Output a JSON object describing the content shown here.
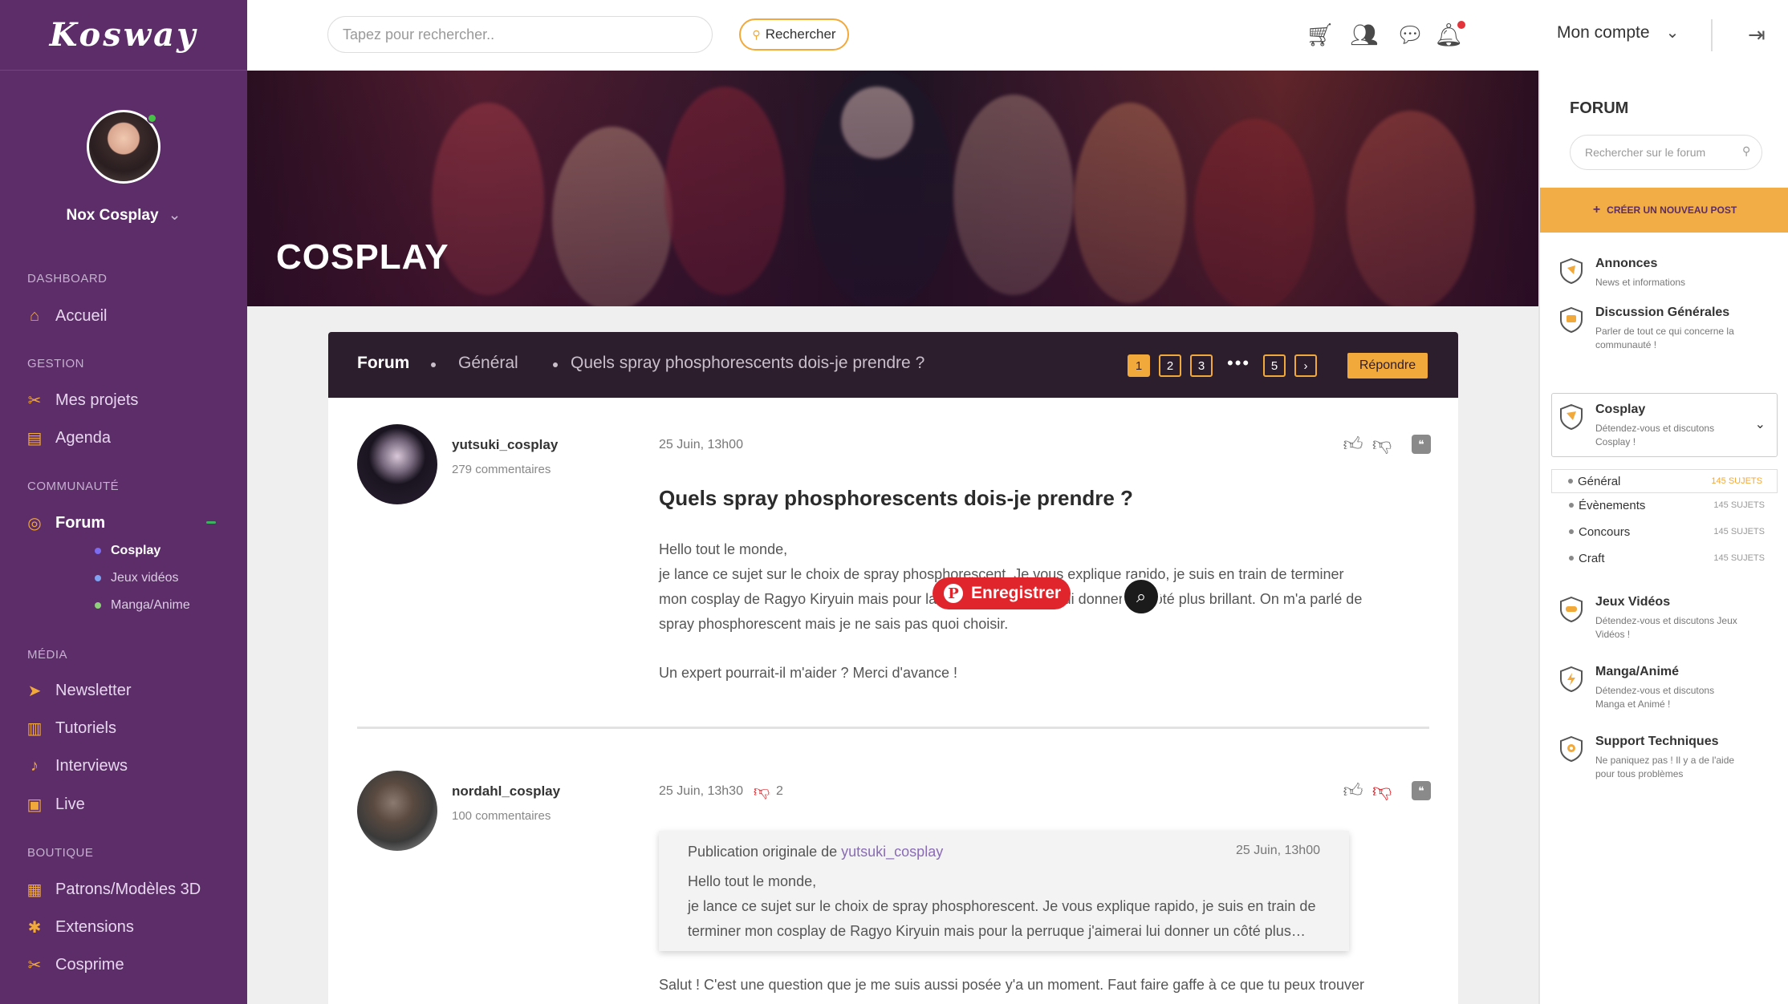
{
  "app": {
    "logo": "Kosway"
  },
  "sidebar": {
    "user": {
      "name": "Nox Cosplay"
    },
    "sections": [
      {
        "title": "Dashboard"
      },
      {
        "title": "Gestion"
      },
      {
        "title": "Communauté"
      },
      {
        "title": "Média"
      },
      {
        "title": "Boutique"
      }
    ],
    "items": {
      "accueil": "Accueil",
      "projets": "Mes projets",
      "agenda": "Agenda",
      "forum": "Forum",
      "newsletter": "Newsletter",
      "tutoriels": "Tutoriels",
      "interviews": "Interviews",
      "live": "Live",
      "patrons": "Patrons/Modèles 3D",
      "extensions": "Extensions",
      "cosprime": "Cosprime"
    },
    "forum_sub": [
      {
        "label": "Cosplay",
        "color": "#7b6cf0"
      },
      {
        "label": "Jeux vidéos",
        "color": "#7fa2f2"
      },
      {
        "label": "Manga/Anime",
        "color": "#8fd07b"
      }
    ]
  },
  "topbar": {
    "search_placeholder": "Tapez pour rechercher..",
    "search_button": "Rechercher",
    "account": "Mon compte",
    "icons": [
      "cart-icon",
      "friends-icon",
      "chat-icon",
      "bell-icon",
      "logout-icon"
    ]
  },
  "hero": {
    "title": "COSPLAY"
  },
  "forum": {
    "breadcrumb": [
      "Forum",
      "Général",
      "Quels spray phosphorescents dois-je prendre ?"
    ],
    "pages": [
      "1",
      "2",
      "3",
      "5"
    ],
    "current_page": "1",
    "reply_label": "Répondre"
  },
  "posts": [
    {
      "author": "yutsuki_cosplay",
      "comments": "279 commentaires",
      "date": "25 Juin, 13h00",
      "title": "Quels spray phosphorescents dois-je prendre ?",
      "greeting": "Hello tout le monde,",
      "body": " je lance ce sujet sur le choix de spray phosphorescent. Je vous explique rapido, je suis en train de terminer mon cosplay de Ragyo Kiryuin mais pour la perruque j'aimerai lui donner un côté plus brillant. On m'a parlé de spray phosphorescent mais je ne sais pas quoi choisir.",
      "closing": "Un expert pourrait-il m'aider ? Merci d'avance !"
    },
    {
      "author": "nordahl_cosplay",
      "comments": "100 commentaires",
      "date": "25 Juin, 13h30",
      "dislikes": "2",
      "quote": {
        "prefix": "Publication originale de ",
        "user": "yutsuki_cosplay",
        "date": "25 Juin, 13h00",
        "text": "Hello tout le monde,\n je lance ce sujet sur le choix de spray phosphorescent. Je vous explique rapido, je suis en train de terminer mon cosplay de Ragyo Kiryuin mais pour la perruque j'aimerai lui donner un côté plus…"
      },
      "reply": "Salut ! C'est une question que je me suis aussi posée y'a un moment. Faut faire gaffe à ce que tu peux trouver"
    }
  ],
  "overlay": {
    "pin_label": "Enregistrer"
  },
  "right_panel": {
    "title": "FORUM",
    "search_placeholder": "Rechercher sur le forum",
    "create_label": "Créer un nouveau post",
    "categories": [
      {
        "name": "Annonces",
        "desc": "News et informations",
        "color": "#f2a93b"
      },
      {
        "name": "Discussion Générales",
        "desc": "Parler de tout ce qui concerne la communauté !",
        "color": "#f2a93b"
      },
      {
        "name": "Cosplay",
        "desc": "Détendez-vous et discutons Cosplay !",
        "color": "#f2a93b"
      },
      {
        "name": "Jeux Vidéos",
        "desc": "Détendez-vous et discutons Jeux Vidéos !",
        "color": "#f2a93b"
      },
      {
        "name": "Manga/Animé",
        "desc": "Détendez-vous et discutons Manga et Animé !",
        "color": "#f2a93b"
      },
      {
        "name": "Support Techniques",
        "desc": "Ne paniquez pas ! Il y a de l'aide pour tous problèmes",
        "color": "#f2a93b"
      }
    ],
    "subcategories": [
      {
        "name": "Général",
        "count": "145 SUJETS"
      },
      {
        "name": "Évènements",
        "count": "145 SUJETS"
      },
      {
        "name": "Concours",
        "count": "145 SUJETS"
      },
      {
        "name": "Craft",
        "count": "145 SUJETS"
      }
    ]
  },
  "colors": {
    "sidebar": "#5c2d68",
    "accent": "#f2a93b",
    "header_dark": "#2d1e2e",
    "pin_red": "#e1252c"
  }
}
